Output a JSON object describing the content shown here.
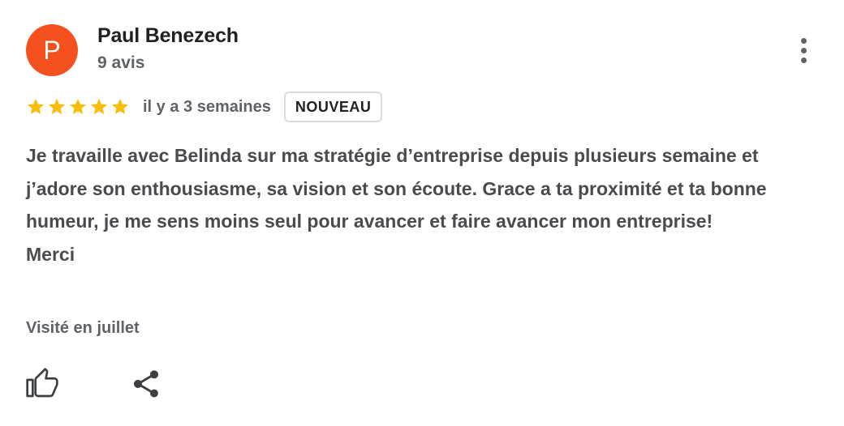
{
  "author": {
    "avatar_letter": "P",
    "avatar_color": "#f4511e",
    "name": "Paul Benezech",
    "review_count": "9 avis"
  },
  "rating": {
    "stars": 5,
    "max_stars": 5,
    "star_color": "#fbbc04",
    "time_ago": "il y a 3 semaines",
    "badge": "NOUVEAU"
  },
  "review": {
    "paragraphs": [
      "Je travaille avec Belinda sur ma stratégie d’entreprise depuis plusieurs semaine et j’adore son enthousiasme, sa vision et son écoute. Grace a ta proximité et ta bonne humeur, je me sens moins seul pour avancer et faire avancer mon entreprise!",
      "Merci"
    ],
    "visited": "Visité en juillet"
  },
  "actions": {
    "more_icon": "more-vertical-icon",
    "like_icon": "thumbs-up-icon",
    "share_icon": "share-icon"
  },
  "colors": {
    "text_primary": "#202124",
    "text_secondary": "#5f6368",
    "badge_border": "#dadce0"
  }
}
